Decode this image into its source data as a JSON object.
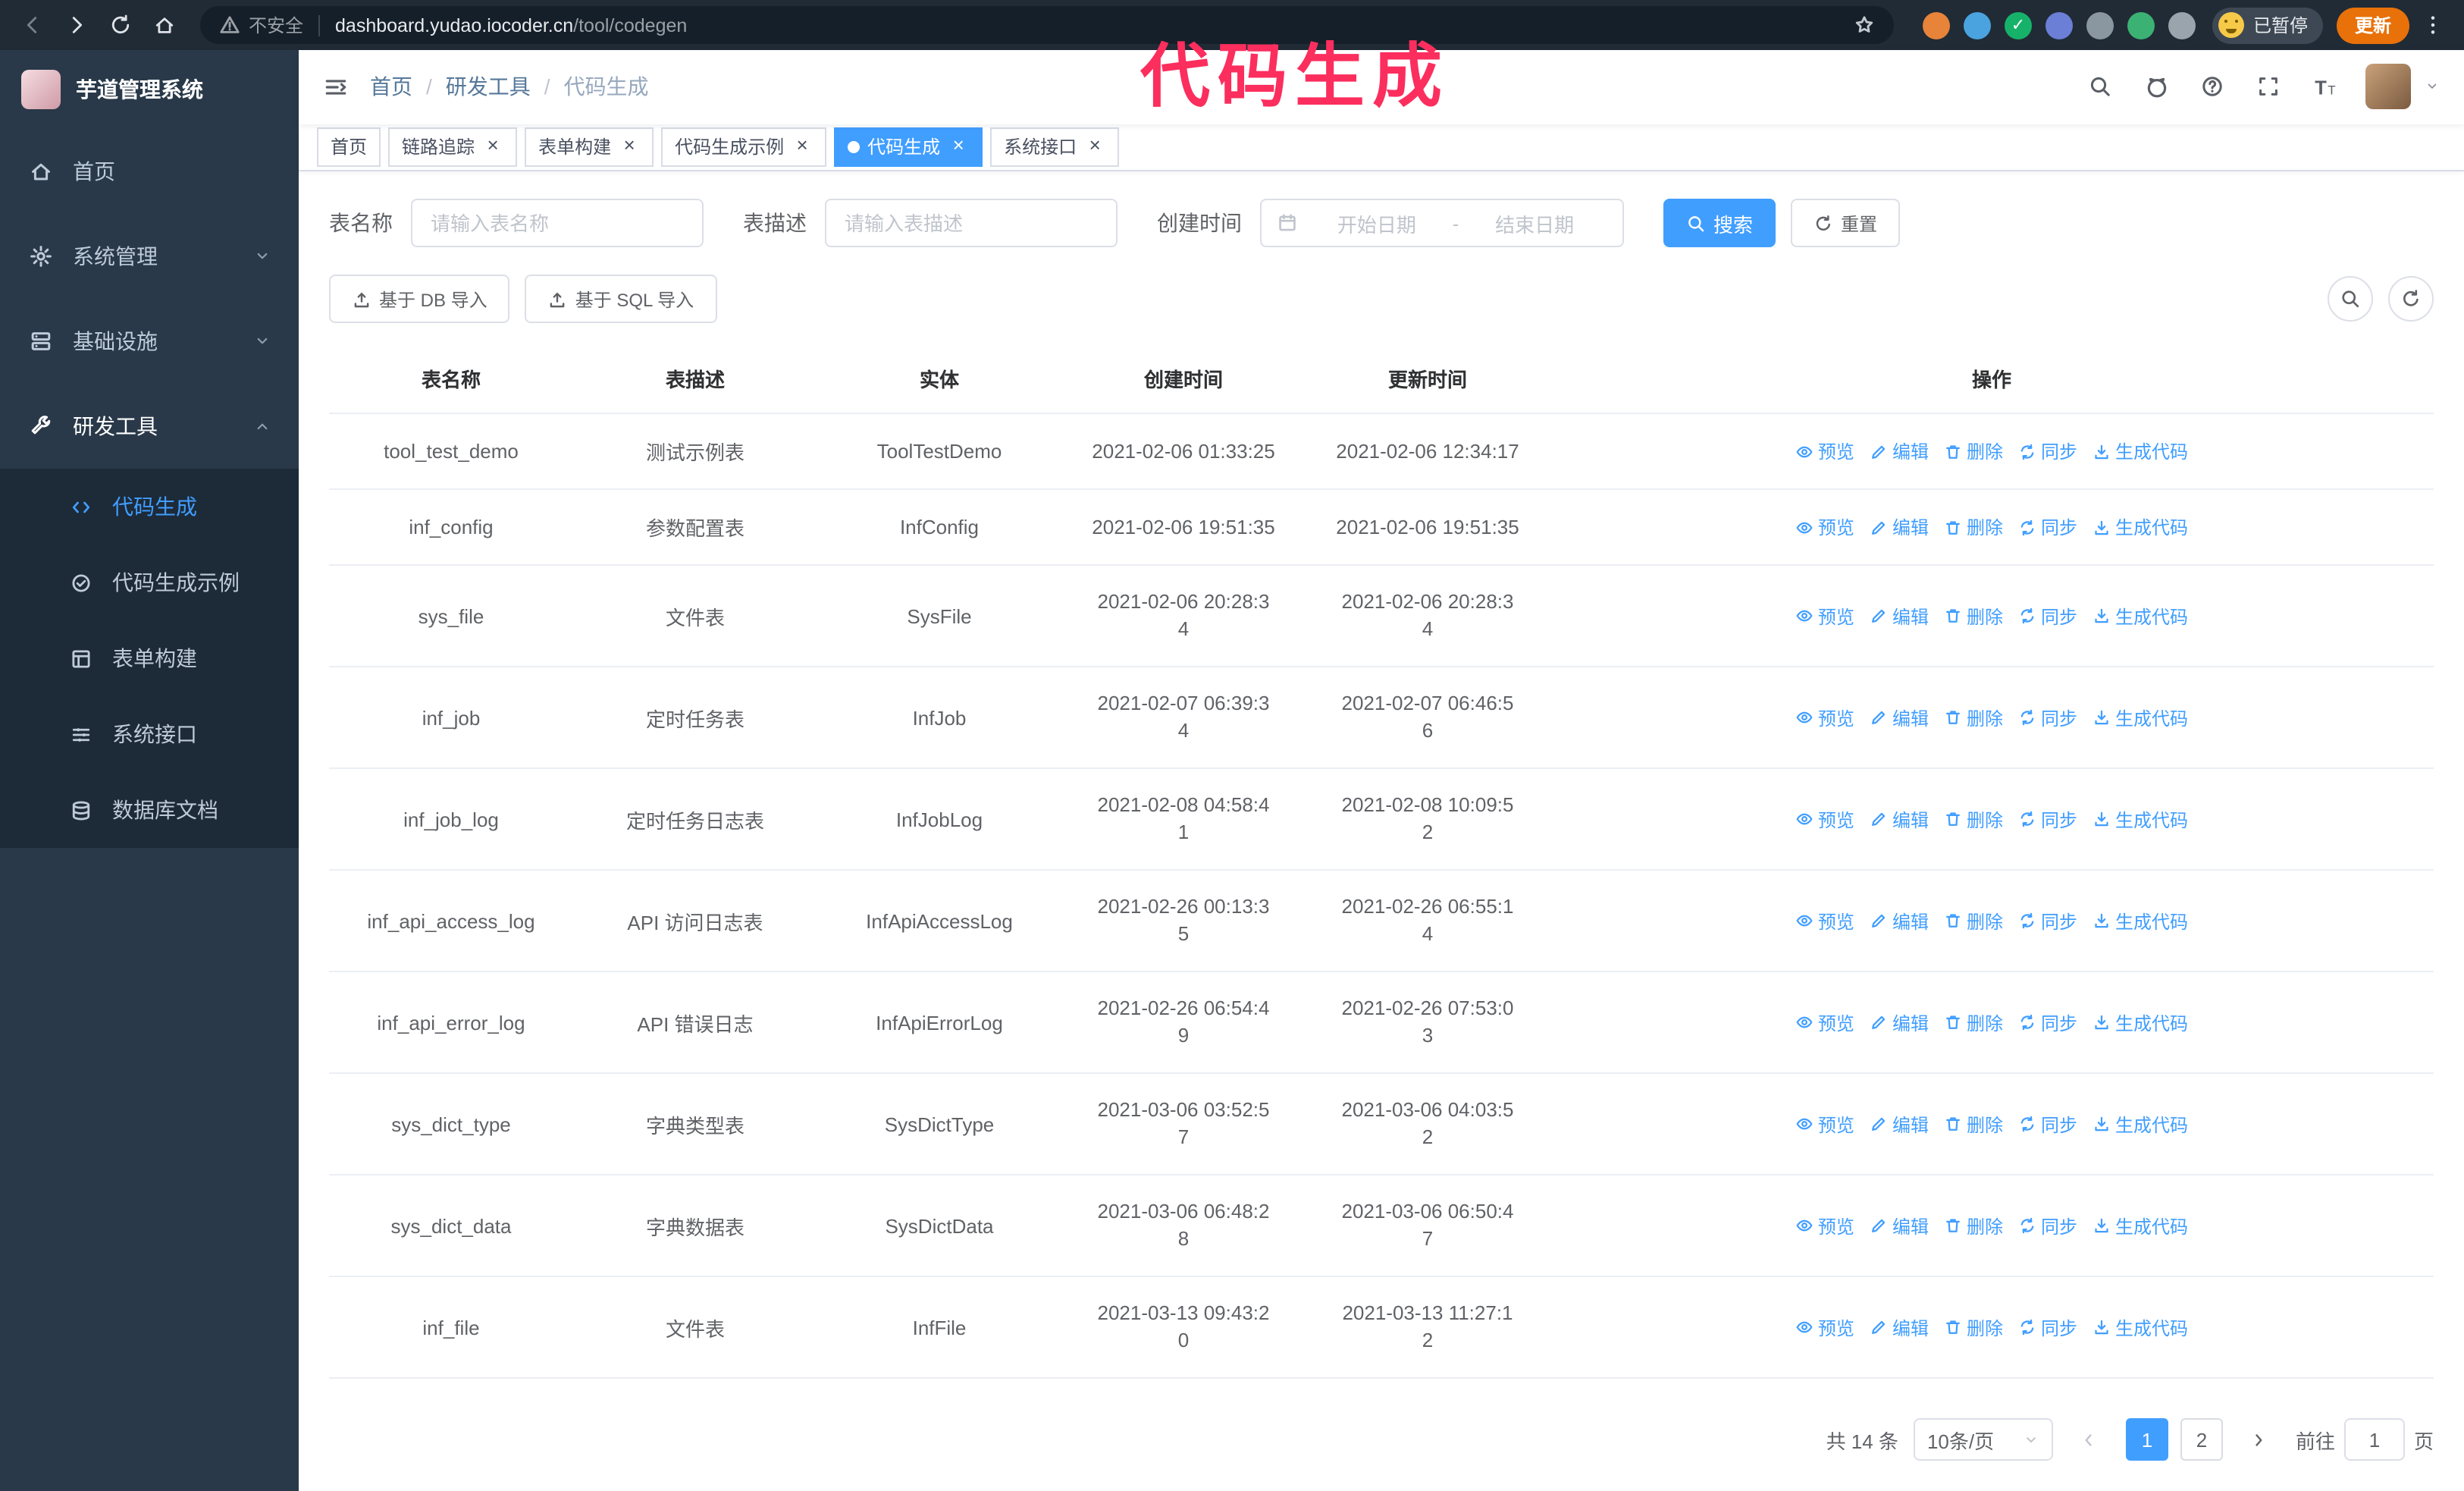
{
  "theme": {
    "primary": "#409eff",
    "link": "#409eff",
    "annotation_color": "#fb2e5e",
    "sidebar_bg": "#293949",
    "submenu_bg": "#1d2a38"
  },
  "annotation": {
    "text": "代码生成"
  },
  "browser": {
    "security_label": "不安全",
    "url_host": "dashboard.yudao.iocoder.cn",
    "url_path": "/tool/codegen",
    "paused_badge_label": "已暂停",
    "update_button_label": "更新",
    "extensions": [
      {
        "name": "fox-extension",
        "color": "#e8833a"
      },
      {
        "name": "drop-extension",
        "color": "#4aa3df"
      },
      {
        "name": "check-extension",
        "color": "#17b26a",
        "glyph": "✓"
      },
      {
        "name": "people-extension",
        "color": "#6b7fd7"
      },
      {
        "name": "gray-extension",
        "color": "#8a97a0"
      },
      {
        "name": "leaf-extension",
        "color": "#3bb273"
      },
      {
        "name": "puzzle-extension",
        "color": "#9aa4ad"
      }
    ]
  },
  "sidebar": {
    "logo_title": "芋道管理系统",
    "menu": [
      {
        "name": "home",
        "label": "首页",
        "icon": "home-icon",
        "expandable": false,
        "expanded": false,
        "active": false
      },
      {
        "name": "system",
        "label": "系统管理",
        "icon": "gear-icon",
        "expandable": true,
        "expanded": false,
        "active": false
      },
      {
        "name": "infra",
        "label": "基础设施",
        "icon": "infra-icon",
        "expandable": true,
        "expanded": false,
        "active": false
      },
      {
        "name": "devtools",
        "label": "研发工具",
        "icon": "tools-icon",
        "expandable": true,
        "expanded": true,
        "active": true
      }
    ],
    "submenu": [
      {
        "name": "codegen",
        "label": "代码生成",
        "icon": "code-icon",
        "active": true
      },
      {
        "name": "codegen-example",
        "label": "代码生成示例",
        "icon": "example-icon",
        "active": false
      },
      {
        "name": "form-builder",
        "label": "表单构建",
        "icon": "form-icon",
        "active": false
      },
      {
        "name": "api",
        "label": "系统接口",
        "icon": "api-icon",
        "active": false
      },
      {
        "name": "db-doc",
        "label": "数据库文档",
        "icon": "database-icon",
        "active": false
      }
    ]
  },
  "navbar": {
    "separator": "/",
    "breadcrumb": [
      {
        "label": "首页"
      },
      {
        "label": "研发工具"
      },
      {
        "label": "代码生成"
      }
    ]
  },
  "tabs": [
    {
      "name": "home",
      "label": "首页",
      "closable": false,
      "active": false
    },
    {
      "name": "tracer",
      "label": "链路追踪",
      "closable": true,
      "active": false
    },
    {
      "name": "form-builder",
      "label": "表单构建",
      "closable": true,
      "active": false
    },
    {
      "name": "codegen-example",
      "label": "代码生成示例",
      "closable": true,
      "active": false
    },
    {
      "name": "codegen",
      "label": "代码生成",
      "closable": true,
      "active": true
    },
    {
      "name": "api",
      "label": "系统接口",
      "closable": true,
      "active": false
    }
  ],
  "filters": {
    "table_name_label": "表名称",
    "table_name_placeholder": "请输入表名称",
    "table_desc_label": "表描述",
    "table_desc_placeholder": "请输入表描述",
    "create_time_label": "创建时间",
    "date_start_placeholder": "开始日期",
    "date_separator": "-",
    "date_end_placeholder": "结束日期",
    "search_button": "搜索",
    "reset_button": "重置"
  },
  "toolbar": {
    "import_db_button": "基于 DB 导入",
    "import_sql_button": "基于 SQL 导入"
  },
  "table": {
    "columns": [
      "表名称",
      "表描述",
      "实体",
      "创建时间",
      "更新时间",
      "操作"
    ],
    "actions": [
      {
        "name": "preview",
        "label": "预览",
        "icon": "eye-icon"
      },
      {
        "name": "edit",
        "label": "编辑",
        "icon": "edit-icon"
      },
      {
        "name": "delete",
        "label": "删除",
        "icon": "delete-icon"
      },
      {
        "name": "sync",
        "label": "同步",
        "icon": "sync-icon"
      },
      {
        "name": "generate",
        "label": "生成代码",
        "icon": "download-icon"
      }
    ],
    "rows": [
      {
        "name": "tool_test_demo",
        "desc": "测试示例表",
        "entity": "ToolTestDemo",
        "create_time": "2021-02-06 01:33:25",
        "update_time": "2021-02-06 12:34:17"
      },
      {
        "name": "inf_config",
        "desc": "参数配置表",
        "entity": "InfConfig",
        "create_time": "2021-02-06 19:51:35",
        "update_time": "2021-02-06 19:51:35"
      },
      {
        "name": "sys_file",
        "desc": "文件表",
        "entity": "SysFile",
        "create_time": "2021-02-06 20:28:34",
        "update_time": "2021-02-06 20:28:34"
      },
      {
        "name": "inf_job",
        "desc": "定时任务表",
        "entity": "InfJob",
        "create_time": "2021-02-07 06:39:34",
        "update_time": "2021-02-07 06:46:56"
      },
      {
        "name": "inf_job_log",
        "desc": "定时任务日志表",
        "entity": "InfJobLog",
        "create_time": "2021-02-08 04:58:41",
        "update_time": "2021-02-08 10:09:52"
      },
      {
        "name": "inf_api_access_log",
        "desc": "API 访问日志表",
        "entity": "InfApiAccessLog",
        "create_time": "2021-02-26 00:13:35",
        "update_time": "2021-02-26 06:55:14"
      },
      {
        "name": "inf_api_error_log",
        "desc": "API 错误日志",
        "entity": "InfApiErrorLog",
        "create_time": "2021-02-26 06:54:49",
        "update_time": "2021-02-26 07:53:03"
      },
      {
        "name": "sys_dict_type",
        "desc": "字典类型表",
        "entity": "SysDictType",
        "create_time": "2021-03-06 03:52:57",
        "update_time": "2021-03-06 04:03:52"
      },
      {
        "name": "sys_dict_data",
        "desc": "字典数据表",
        "entity": "SysDictData",
        "create_time": "2021-03-06 06:48:28",
        "update_time": "2021-03-06 06:50:47"
      },
      {
        "name": "inf_file",
        "desc": "文件表",
        "entity": "InfFile",
        "create_time": "2021-03-13 09:43:20",
        "update_time": "2021-03-13 11:27:12"
      }
    ]
  },
  "pagination": {
    "total_text": "共 14 条",
    "page_size": "10条/页",
    "pages": [
      "1",
      "2"
    ],
    "active_page": "1",
    "goto_label": "前往",
    "goto_value": "1",
    "goto_suffix": "页"
  }
}
